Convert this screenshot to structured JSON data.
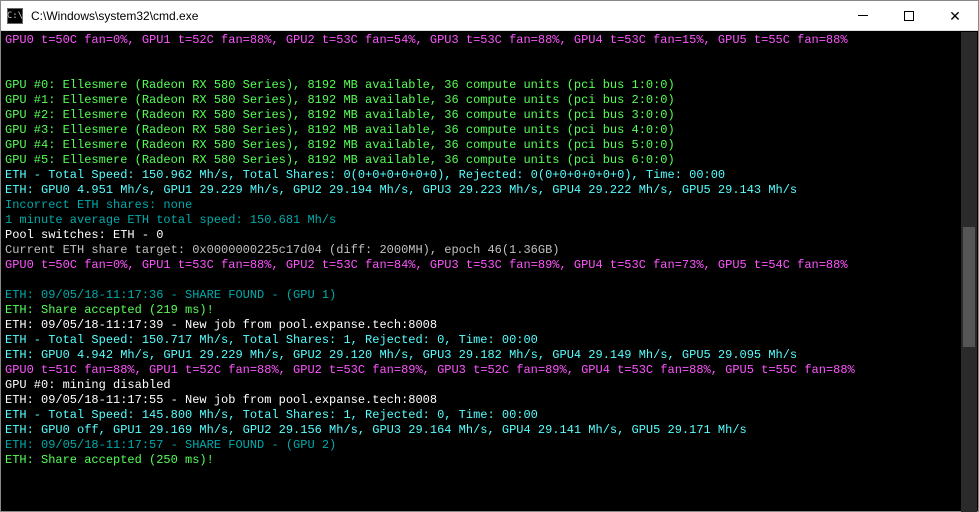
{
  "window": {
    "icon_text": "C:\\",
    "title": "C:\\Windows\\system32\\cmd.exe"
  },
  "lines": [
    {
      "cls": "magenta",
      "t": "GPU0 t=50C fan=0%, GPU1 t=52C fan=88%, GPU2 t=53C fan=54%, GPU3 t=53C fan=88%, GPU4 t=53C fan=15%, GPU5 t=55C fan=88%"
    },
    {
      "cls": "",
      "t": ""
    },
    {
      "cls": "",
      "t": ""
    },
    {
      "cls": "green",
      "t": "GPU #0: Ellesmere (Radeon RX 580 Series), 8192 MB available, 36 compute units (pci bus 1:0:0)"
    },
    {
      "cls": "green",
      "t": "GPU #1: Ellesmere (Radeon RX 580 Series), 8192 MB available, 36 compute units (pci bus 2:0:0)"
    },
    {
      "cls": "green",
      "t": "GPU #2: Ellesmere (Radeon RX 580 Series), 8192 MB available, 36 compute units (pci bus 3:0:0)"
    },
    {
      "cls": "green",
      "t": "GPU #3: Ellesmere (Radeon RX 580 Series), 8192 MB available, 36 compute units (pci bus 4:0:0)"
    },
    {
      "cls": "green",
      "t": "GPU #4: Ellesmere (Radeon RX 580 Series), 8192 MB available, 36 compute units (pci bus 5:0:0)"
    },
    {
      "cls": "green",
      "t": "GPU #5: Ellesmere (Radeon RX 580 Series), 8192 MB available, 36 compute units (pci bus 6:0:0)"
    },
    {
      "cls": "cyan",
      "t": "ETH - Total Speed: 150.962 Mh/s, Total Shares: 0(0+0+0+0+0+0), Rejected: 0(0+0+0+0+0+0), Time: 00:00"
    },
    {
      "cls": "cyan",
      "t": "ETH: GPU0 4.951 Mh/s, GPU1 29.229 Mh/s, GPU2 29.194 Mh/s, GPU3 29.223 Mh/s, GPU4 29.222 Mh/s, GPU5 29.143 Mh/s"
    },
    {
      "cls": "teal",
      "t": "Incorrect ETH shares: none"
    },
    {
      "cls": "teal",
      "t": "1 minute average ETH total speed: 150.681 Mh/s"
    },
    {
      "cls": "white",
      "t": "Pool switches: ETH - 0"
    },
    {
      "cls": "gray",
      "t": "Current ETH share target: 0x0000000225c17d04 (diff: 2000MH), epoch 46(1.36GB)"
    },
    {
      "cls": "magenta",
      "t": "GPU0 t=50C fan=0%, GPU1 t=53C fan=88%, GPU2 t=53C fan=84%, GPU3 t=53C fan=89%, GPU4 t=53C fan=73%, GPU5 t=54C fan=88%"
    },
    {
      "cls": "",
      "t": ""
    },
    {
      "cls": "teal",
      "t": "ETH: 09/05/18-11:17:36 - SHARE FOUND - (GPU 1)"
    },
    {
      "cls": "green",
      "t": "ETH: Share accepted (219 ms)!"
    },
    {
      "cls": "white",
      "t": "ETH: 09/05/18-11:17:39 - New job from pool.expanse.tech:8008"
    },
    {
      "cls": "cyan",
      "t": "ETH - Total Speed: 150.717 Mh/s, Total Shares: 1, Rejected: 0, Time: 00:00"
    },
    {
      "cls": "cyan",
      "t": "ETH: GPU0 4.942 Mh/s, GPU1 29.229 Mh/s, GPU2 29.120 Mh/s, GPU3 29.182 Mh/s, GPU4 29.149 Mh/s, GPU5 29.095 Mh/s"
    },
    {
      "cls": "magenta",
      "t": "GPU0 t=51C fan=88%, GPU1 t=52C fan=88%, GPU2 t=53C fan=89%, GPU3 t=52C fan=89%, GPU4 t=53C fan=88%, GPU5 t=55C fan=88%"
    },
    {
      "cls": "white",
      "t": "GPU #0: mining disabled"
    },
    {
      "cls": "white",
      "t": "ETH: 09/05/18-11:17:55 - New job from pool.expanse.tech:8008"
    },
    {
      "cls": "cyan",
      "t": "ETH - Total Speed: 145.800 Mh/s, Total Shares: 1, Rejected: 0, Time: 00:00"
    },
    {
      "cls": "cyan",
      "t": "ETH: GPU0 off, GPU1 29.169 Mh/s, GPU2 29.156 Mh/s, GPU3 29.164 Mh/s, GPU4 29.141 Mh/s, GPU5 29.171 Mh/s"
    },
    {
      "cls": "teal",
      "t": "ETH: 09/05/18-11:17:57 - SHARE FOUND - (GPU 2)"
    },
    {
      "cls": "green",
      "t": "ETH: Share accepted (250 ms)!"
    }
  ]
}
